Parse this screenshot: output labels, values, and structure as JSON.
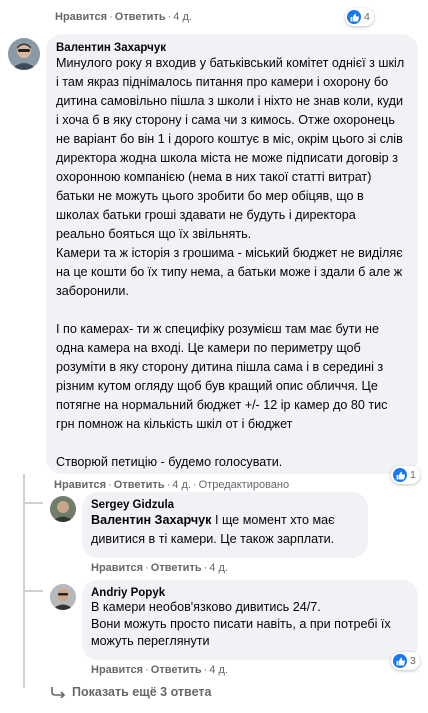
{
  "top_meta": {
    "like": "Нравится",
    "reply": "Ответить",
    "time": "4 д.",
    "reactions": "4"
  },
  "main_comment": {
    "author": "Валентин Захарчук",
    "paragraph1": "Минулого року я входив у батьківський комітет однієї з шкіл і там якраз піднімалось питання про камери і охорону бо дитина самовільно пішла з школи і ніхто не знав коли, куди і хоча б в яку сторону і сама чи з кимось. Отже охоронець не варіант бо він 1 і дорого коштує в міс, окрім цього зі слів директора жодна школа міста не може підписати договір з охоронною компанією (нема в них такої статті витрат) батьки не можуть цього зробити бо мер обіцяв, що в школах батьки гроші здавати не будуть і директора реально бояться що їх звільнять.",
    "paragraph2": "Камери та ж історія з грошима - міський бюджет не виділяє на це кошти бо їх типу нема, а батьки може і здали б але ж заборонили.",
    "paragraph3": "І по камерах- ти ж специфіку розумієш там має бути не одна камера на вході. Це камери по периметру щоб розуміти в яку сторону дитина пішла сама і в середині з різним кутом огляду щоб був кращий опис обличчя. Це потягне на нормальний бюджет +/- 12 ір камер до 80 тис грн помнож на кількість шкіл от і бюджет",
    "paragraph4": "Створюй петицію - будемо голосувати.",
    "like": "Нравится",
    "reply": "Ответить",
    "time": "4 д.",
    "edited": "Отредактировано",
    "reactions": "1"
  },
  "reply1": {
    "author": "Sergey Gidzula",
    "mention": "Валентин Захарчук",
    "text": "І ще момент хто має дивитися в ті камери. Це також зарплати.",
    "like": "Нравится",
    "reply": "Ответить",
    "time": "4 д."
  },
  "reply2": {
    "author": "Andriy Popyk",
    "line1": "В камери необов'язково дивитись 24/7.",
    "line2": "Вони можуть просто писати навіть, а при потребі їх можуть переглянути",
    "like": "Нравится",
    "reply": "Ответить",
    "time": "4 д.",
    "reactions": "3"
  },
  "show_more": "Показать ещё 3 ответа",
  "colors": {
    "like_blue": "#1877f2",
    "bubble_gray": "#f0f2f5",
    "meta_gray": "#65676b"
  },
  "icons": [
    "like-icon",
    "reply-arrow-icon"
  ]
}
